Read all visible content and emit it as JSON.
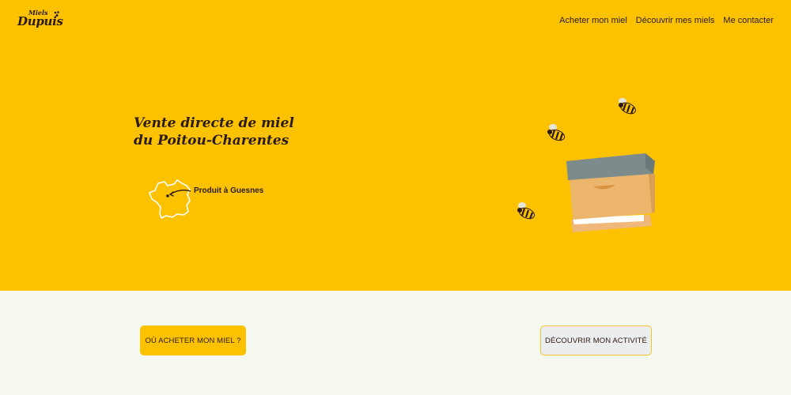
{
  "brand": {
    "logo_small": "Miels",
    "logo_big": "Dupuis"
  },
  "nav": {
    "items": [
      {
        "label": "Acheter mon miel"
      },
      {
        "label": "Découvrir mes miels"
      },
      {
        "label": "Me contacter"
      }
    ]
  },
  "hero": {
    "headline_line1": "Vente directe de miel",
    "headline_line2": "du Poitou-Charentes",
    "origin_label": "Produit à Guesnes"
  },
  "actions": {
    "primary_label": "OÙ ACHETER MON MIEL ?",
    "secondary_label": "DÉCOUVRIR MON ACTIVITÉ"
  },
  "colors": {
    "hero_background": "#fcc200",
    "page_background": "#f4f8ee",
    "text_dark": "#2b1a10",
    "hive_lid": "#7d8b8c",
    "hive_body": "#e9b46a"
  },
  "icons": {
    "logo_bee": "bee-icon",
    "map": "france-map-icon",
    "hive": "beehive-icon",
    "bees": [
      "bee-icon",
      "bee-icon",
      "bee-icon"
    ]
  }
}
